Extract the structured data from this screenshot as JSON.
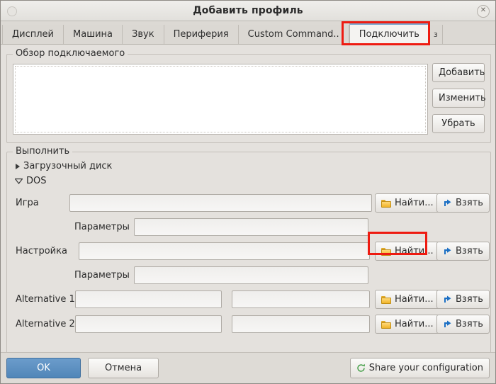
{
  "window": {
    "title": "Добавить профиль",
    "close_label": "✕"
  },
  "tabs": [
    {
      "label": "Дисплей",
      "active": false
    },
    {
      "label": "Машина",
      "active": false
    },
    {
      "label": "Звук",
      "active": false
    },
    {
      "label": "Периферия",
      "active": false
    },
    {
      "label": "Custom Command..",
      "active": false
    },
    {
      "label": "Подключить",
      "active": true
    },
    {
      "label": "з",
      "active": false,
      "partial": true
    }
  ],
  "overview_group": {
    "legend": "Обзор подключаемого",
    "list_items": [],
    "buttons": [
      {
        "label": "Добавить"
      },
      {
        "label": "Изменить"
      },
      {
        "label": "Убрать"
      }
    ]
  },
  "run_group": {
    "legend": "Выполнить",
    "tree": [
      {
        "label": "Загрузочный диск",
        "expanded": false
      },
      {
        "label": "DOS",
        "expanded": true
      }
    ],
    "rows": [
      {
        "label": "Игра",
        "value": "",
        "placeholder": "",
        "find_label": "Найти...",
        "take_label": "Взять"
      },
      {
        "label": "Параметры",
        "value": "",
        "placeholder": ""
      },
      {
        "label": "Настройка",
        "value": "",
        "placeholder": "",
        "find_label": "Найти...",
        "take_label": "Взять"
      },
      {
        "label": "Параметры",
        "value": "",
        "placeholder": ""
      },
      {
        "label": "Alternative 1",
        "value": "",
        "value2": "",
        "placeholder": "",
        "find_label": "Найти...",
        "take_label": "Взять"
      },
      {
        "label": "Alternative 2",
        "value": "",
        "value2": "",
        "placeholder": "",
        "find_label": "Найти...",
        "take_label": "Взять"
      }
    ]
  },
  "footer": {
    "ok_label": "OK",
    "cancel_label": "Отмена",
    "share_label": "Share your configuration"
  },
  "colors": {
    "accent_blue": "#5186b8",
    "annotation_red": "#ee1b11",
    "share_green": "#3f9d43",
    "folder_yellow": "#f0b429"
  },
  "annotations": [
    {
      "target": "tab-podklyuchit",
      "color": "#ee1b11"
    },
    {
      "target": "find-button-game",
      "color": "#ee1b11"
    }
  ]
}
